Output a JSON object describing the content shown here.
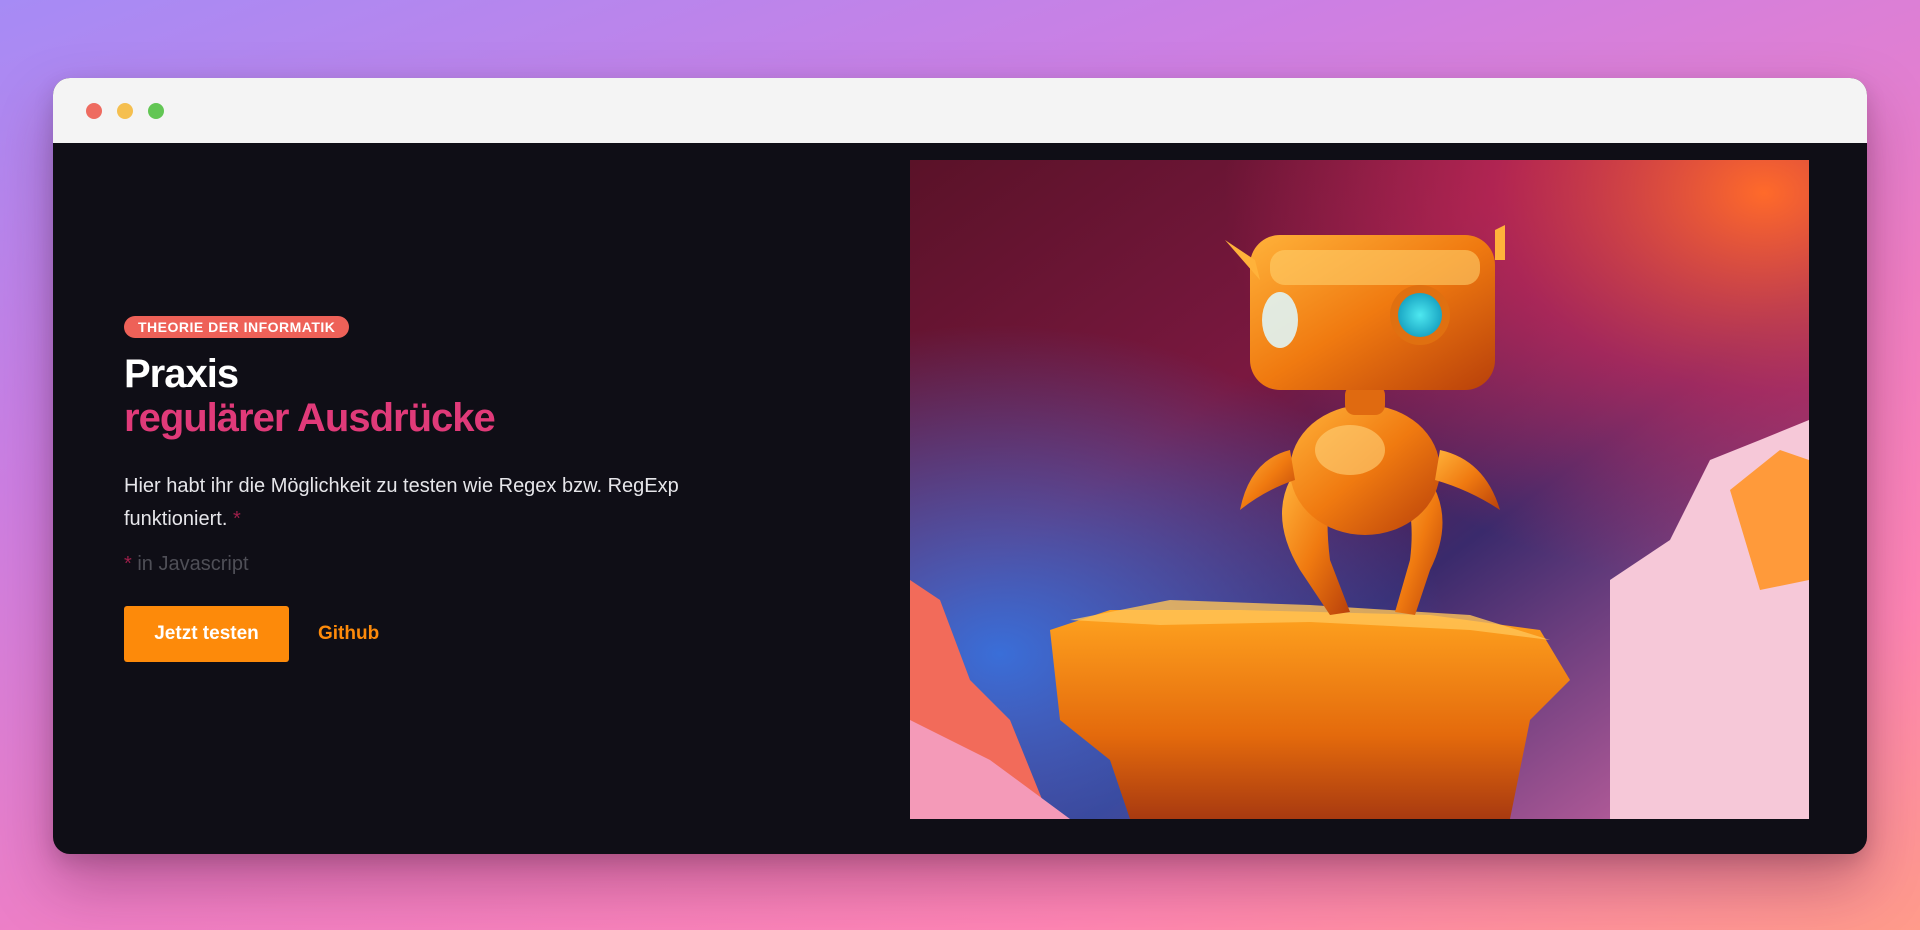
{
  "window": {
    "controls": [
      "close-icon",
      "minimize-icon",
      "maximize-icon"
    ]
  },
  "hero": {
    "badge": "THEORIE DER INFORMATIK",
    "title_line1": "Praxis",
    "title_line2": "regulärer Ausdrücke",
    "description": "Hier habt ihr die Möglichkeit zu testen wie Regex bzw. RegExp funktioniert.",
    "description_marker": "*",
    "footnote_marker": "*",
    "footnote_text": "in Javascript",
    "primary_button_label": "Jetzt testen",
    "secondary_link_label": "Github"
  },
  "image": {
    "subject": "orange-robot-illustration"
  },
  "colors": {
    "accent_orange": "#fd8a0a",
    "title_pink": "#e03a79",
    "badge_red": "#ee6158",
    "window_bg": "#0f0e16"
  }
}
